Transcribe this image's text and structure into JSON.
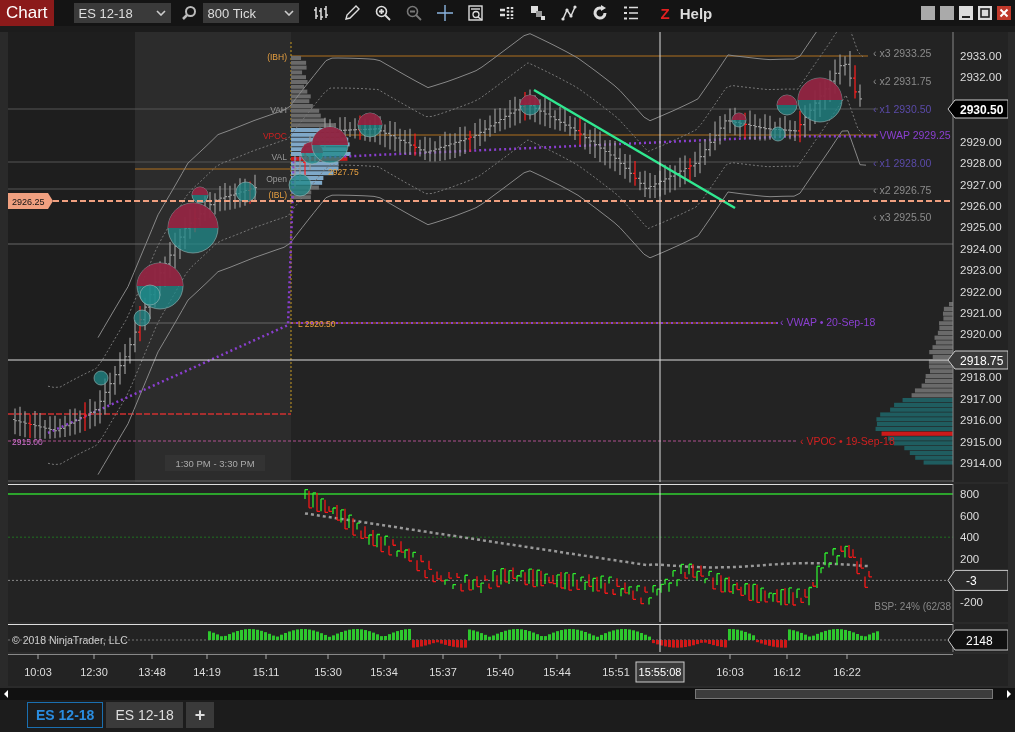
{
  "toolbar": {
    "title": "Chart",
    "instrument": "ES 12-18",
    "interval": "800 Tick",
    "z_label": "Z",
    "help": "Help"
  },
  "price_panel": {
    "ticks": [
      "2933.00",
      "2932.00",
      "2929.00",
      "2928.00",
      "2927.00",
      "2926.00",
      "2925.00",
      "2924.00",
      "2923.00",
      "2922.00",
      "2921.00",
      "2920.00",
      "2918.00",
      "2917.00",
      "2916.00",
      "2915.00",
      "2914.00"
    ],
    "labels": [
      {
        "text": "(IBH)",
        "kind": "ib"
      },
      {
        "text": "VAH",
        "kind": "profile"
      },
      {
        "text": "VPOC",
        "kind": "poc"
      },
      {
        "text": "VAL",
        "kind": "profile"
      },
      {
        "text": "Open",
        "kind": "profile"
      },
      {
        "text": "2927.75",
        "kind": "ib"
      },
      {
        "text": "(IBL)",
        "kind": "ib"
      },
      {
        "text": "L 2920.50",
        "kind": "ib"
      },
      {
        "text": "2915.00",
        "kind": "prior"
      },
      {
        "text": "‹ x3 2933.25",
        "kind": "band"
      },
      {
        "text": "‹ x2 2931.75",
        "kind": "band"
      },
      {
        "text": "‹ x1 2930.50",
        "kind": "inner"
      },
      {
        "text": "‹ VWAP 2929.25",
        "kind": "vwap"
      },
      {
        "text": "‹ x1 2928.00",
        "kind": "inner"
      },
      {
        "text": "‹ x2 2926.75",
        "kind": "band"
      },
      {
        "text": "‹ x3 2925.50",
        "kind": "band"
      },
      {
        "text": "‹ VWAP • 20-Sep-18",
        "kind": "vwap"
      },
      {
        "text": "‹ VPOC • 19-Sep-18",
        "kind": "poc"
      }
    ],
    "session_label": "1:30 PM - 3:30 PM",
    "left_marker": "2926.25",
    "last_price": "2930.50",
    "crosshair_price": "2918.75"
  },
  "delta_panel": {
    "ticks": [
      "800",
      "600",
      "400",
      "200",
      "-200"
    ],
    "marker": "-3",
    "bsp": "BSP: 24% (62/38"
  },
  "volume_panel": {
    "copyright": "© 2018 NinjaTrader, LLC",
    "marker": "2148"
  },
  "time_axis": {
    "ticks": [
      "10:03",
      "12:30",
      "13:48",
      "14:19",
      "15:11",
      "15:30",
      "15:34",
      "15:37",
      "15:40",
      "15:44",
      "15:51",
      "16:03",
      "16:12",
      "16:22"
    ],
    "crosshair_time": "15:55:08"
  },
  "tabs": [
    {
      "label": "ES 12-18",
      "selected": true
    },
    {
      "label": "ES 12-18",
      "selected": false
    }
  ],
  "add_tab": "+"
}
